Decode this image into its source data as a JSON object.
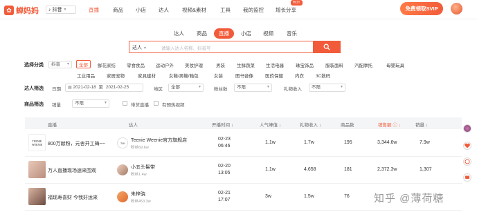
{
  "header": {
    "logo": "蝉妈妈",
    "platform": "抖音",
    "nav": [
      "直播",
      "商品",
      "小店",
      "达人",
      "视频&素材",
      "工具",
      "我的监控",
      "增长分享"
    ],
    "hot_badge": "HOT",
    "vip_button": "免费领取SVIP"
  },
  "search": {
    "tabs": [
      "达人",
      "商品",
      "直播",
      "小店",
      "视频",
      "音乐"
    ],
    "type": "达人",
    "placeholder": "请输入达人名称、抖音号"
  },
  "filters": {
    "category_label": "选择分类",
    "category_select": "抖音",
    "categories": [
      "全部",
      "鲜花家纺",
      "零食食品",
      "运动户外",
      "美妆护理",
      "男装",
      "生鲜蔬菜",
      "生活电器",
      "珠宝饰品",
      "服装面料",
      "汽配摩托",
      "母婴玩具",
      "工业用品",
      "家居宠物",
      "家具建材",
      "女鞋/男鞋/箱包",
      "女装",
      "图书音像",
      "医药保健",
      "内衣",
      "3C数码"
    ],
    "anchor_label": "达人筛选",
    "date_label": "日期",
    "date_start": "2021-02-18",
    "date_sep": "至",
    "date_end": "2021-02-25",
    "region_label": "地区",
    "region_value": "全部",
    "fans_label": "粉丝数",
    "fans_value": "不限",
    "gift_label": "礼物收入",
    "gift_value": "不限",
    "goods_label": "商品筛选",
    "sales_label": "销量",
    "sales_value": "不限",
    "with_goods": "带货直播",
    "with_preview": "有预热视频"
  },
  "table": {
    "columns": [
      "直播",
      "达人",
      "开播时间",
      "人气峰值",
      "礼物收入",
      "商品数",
      "销售额",
      "销量"
    ],
    "rows": [
      {
        "title": "800万献粉，元舍开工梅~~",
        "thumb_text": "TEENIE WEENIE",
        "anchor": "Teenie Weenie官方旗舰店",
        "anchor_fans": "粉丝69.6w",
        "date": "02-23",
        "time": "06:46",
        "peak": "1.1w",
        "gift": "1.7w",
        "goods": "195",
        "sales": "3,344.6w",
        "volume": "7.9w"
      },
      {
        "title": "万人直播现场速来围观",
        "thumb_text": "",
        "anchor": "小五头髻带",
        "anchor_fans": "粉丝1.4w",
        "date": "02-20",
        "time": "13:05",
        "peak": "1.1w",
        "gift": "4,658",
        "goods": "181",
        "sales": "2,372.3w",
        "volume": "1,307"
      },
      {
        "title": "福现寿喜财 今我好运来",
        "thumb_text": "",
        "anchor": "朱梓骁",
        "anchor_fans": "粉丝453.3w",
        "date": "02-21",
        "time": "17:07",
        "peak": "3w",
        "gift": "1.5w",
        "goods": "76",
        "sales": "",
        "volume": ""
      }
    ]
  },
  "watermark": "知乎 @薄荷糖",
  "colors": {
    "accent": "#f25b3a"
  }
}
